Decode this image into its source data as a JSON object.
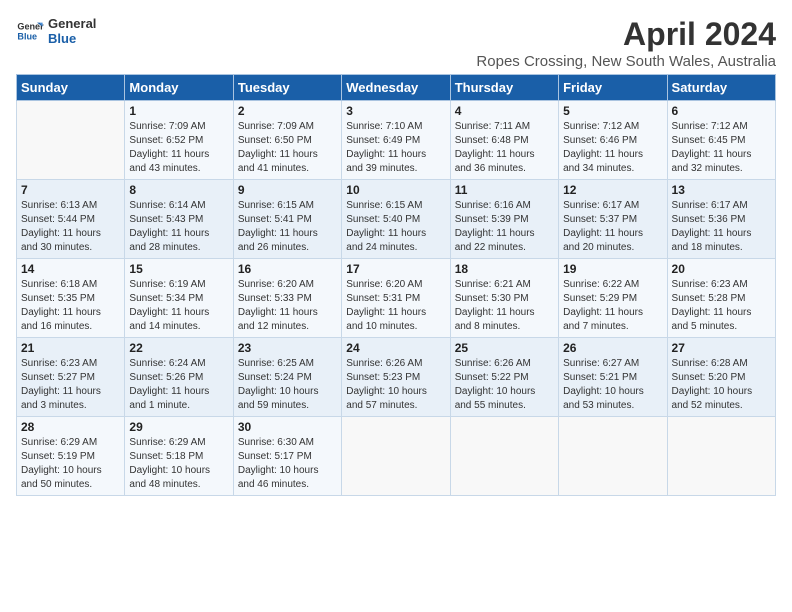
{
  "logo": {
    "line1": "General",
    "line2": "Blue"
  },
  "title": "April 2024",
  "subtitle": "Ropes Crossing, New South Wales, Australia",
  "days_of_week": [
    "Sunday",
    "Monday",
    "Tuesday",
    "Wednesday",
    "Thursday",
    "Friday",
    "Saturday"
  ],
  "weeks": [
    [
      {
        "day": "",
        "info": ""
      },
      {
        "day": "1",
        "info": "Sunrise: 7:09 AM\nSunset: 6:52 PM\nDaylight: 11 hours\nand 43 minutes."
      },
      {
        "day": "2",
        "info": "Sunrise: 7:09 AM\nSunset: 6:50 PM\nDaylight: 11 hours\nand 41 minutes."
      },
      {
        "day": "3",
        "info": "Sunrise: 7:10 AM\nSunset: 6:49 PM\nDaylight: 11 hours\nand 39 minutes."
      },
      {
        "day": "4",
        "info": "Sunrise: 7:11 AM\nSunset: 6:48 PM\nDaylight: 11 hours\nand 36 minutes."
      },
      {
        "day": "5",
        "info": "Sunrise: 7:12 AM\nSunset: 6:46 PM\nDaylight: 11 hours\nand 34 minutes."
      },
      {
        "day": "6",
        "info": "Sunrise: 7:12 AM\nSunset: 6:45 PM\nDaylight: 11 hours\nand 32 minutes."
      }
    ],
    [
      {
        "day": "7",
        "info": "Sunrise: 6:13 AM\nSunset: 5:44 PM\nDaylight: 11 hours\nand 30 minutes."
      },
      {
        "day": "8",
        "info": "Sunrise: 6:14 AM\nSunset: 5:43 PM\nDaylight: 11 hours\nand 28 minutes."
      },
      {
        "day": "9",
        "info": "Sunrise: 6:15 AM\nSunset: 5:41 PM\nDaylight: 11 hours\nand 26 minutes."
      },
      {
        "day": "10",
        "info": "Sunrise: 6:15 AM\nSunset: 5:40 PM\nDaylight: 11 hours\nand 24 minutes."
      },
      {
        "day": "11",
        "info": "Sunrise: 6:16 AM\nSunset: 5:39 PM\nDaylight: 11 hours\nand 22 minutes."
      },
      {
        "day": "12",
        "info": "Sunrise: 6:17 AM\nSunset: 5:37 PM\nDaylight: 11 hours\nand 20 minutes."
      },
      {
        "day": "13",
        "info": "Sunrise: 6:17 AM\nSunset: 5:36 PM\nDaylight: 11 hours\nand 18 minutes."
      }
    ],
    [
      {
        "day": "14",
        "info": "Sunrise: 6:18 AM\nSunset: 5:35 PM\nDaylight: 11 hours\nand 16 minutes."
      },
      {
        "day": "15",
        "info": "Sunrise: 6:19 AM\nSunset: 5:34 PM\nDaylight: 11 hours\nand 14 minutes."
      },
      {
        "day": "16",
        "info": "Sunrise: 6:20 AM\nSunset: 5:33 PM\nDaylight: 11 hours\nand 12 minutes."
      },
      {
        "day": "17",
        "info": "Sunrise: 6:20 AM\nSunset: 5:31 PM\nDaylight: 11 hours\nand 10 minutes."
      },
      {
        "day": "18",
        "info": "Sunrise: 6:21 AM\nSunset: 5:30 PM\nDaylight: 11 hours\nand 8 minutes."
      },
      {
        "day": "19",
        "info": "Sunrise: 6:22 AM\nSunset: 5:29 PM\nDaylight: 11 hours\nand 7 minutes."
      },
      {
        "day": "20",
        "info": "Sunrise: 6:23 AM\nSunset: 5:28 PM\nDaylight: 11 hours\nand 5 minutes."
      }
    ],
    [
      {
        "day": "21",
        "info": "Sunrise: 6:23 AM\nSunset: 5:27 PM\nDaylight: 11 hours\nand 3 minutes."
      },
      {
        "day": "22",
        "info": "Sunrise: 6:24 AM\nSunset: 5:26 PM\nDaylight: 11 hours\nand 1 minute."
      },
      {
        "day": "23",
        "info": "Sunrise: 6:25 AM\nSunset: 5:24 PM\nDaylight: 10 hours\nand 59 minutes."
      },
      {
        "day": "24",
        "info": "Sunrise: 6:26 AM\nSunset: 5:23 PM\nDaylight: 10 hours\nand 57 minutes."
      },
      {
        "day": "25",
        "info": "Sunrise: 6:26 AM\nSunset: 5:22 PM\nDaylight: 10 hours\nand 55 minutes."
      },
      {
        "day": "26",
        "info": "Sunrise: 6:27 AM\nSunset: 5:21 PM\nDaylight: 10 hours\nand 53 minutes."
      },
      {
        "day": "27",
        "info": "Sunrise: 6:28 AM\nSunset: 5:20 PM\nDaylight: 10 hours\nand 52 minutes."
      }
    ],
    [
      {
        "day": "28",
        "info": "Sunrise: 6:29 AM\nSunset: 5:19 PM\nDaylight: 10 hours\nand 50 minutes."
      },
      {
        "day": "29",
        "info": "Sunrise: 6:29 AM\nSunset: 5:18 PM\nDaylight: 10 hours\nand 48 minutes."
      },
      {
        "day": "30",
        "info": "Sunrise: 6:30 AM\nSunset: 5:17 PM\nDaylight: 10 hours\nand 46 minutes."
      },
      {
        "day": "",
        "info": ""
      },
      {
        "day": "",
        "info": ""
      },
      {
        "day": "",
        "info": ""
      },
      {
        "day": "",
        "info": ""
      }
    ]
  ]
}
